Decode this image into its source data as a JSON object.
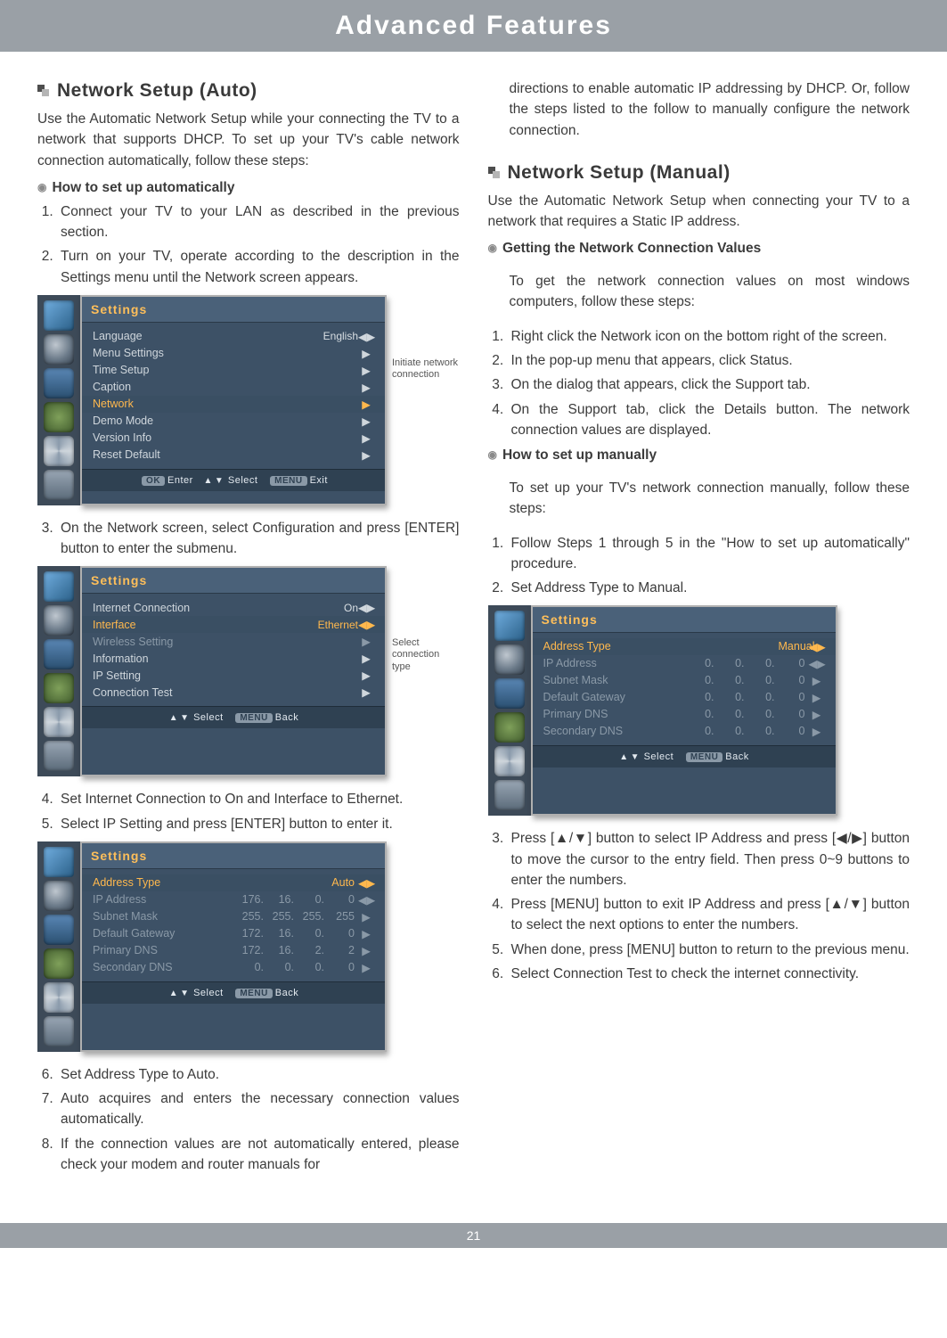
{
  "banner": "Advanced Features",
  "page_number": "21",
  "left": {
    "h_auto": "Network Setup (Auto)",
    "lead_auto": "Use the Automatic Network Setup while your connecting the TV to a network that supports DHCP. To set up your TV's cable network connection automatically, follow these steps:",
    "sub_auto": "How to set up automatically",
    "step1": "Connect your TV to your LAN as described in the previous section.",
    "step2": "Turn on your TV, operate according to the description in the Settings menu until the Network screen appears.",
    "step3": "On the Network screen, select Configuration and press [ENTER] button to enter the submenu.",
    "step4": "Set Internet Connection to On and Interface to Ethernet.",
    "step5": "Select IP Setting and press [ENTER] button to enter it.",
    "step6": "Set Address Type to Auto.",
    "step7": "Auto acquires and enters the necessary connection values automatically.",
    "step8": "If the connection values are not automatically entered, please check your modem and router manuals for",
    "callout1": "Initiate network connection",
    "callout2": "Select connection type"
  },
  "right": {
    "cont": "directions to enable automatic IP addressing by DHCP. Or, follow the steps listed to the follow to manually configure the network connection.",
    "h_manual": "Network Setup (Manual)",
    "lead_manual": "Use the Automatic Network Setup when connecting your TV to a network that requires a Static IP address.",
    "sub_get": "Getting the Network Connection Values",
    "get_lead": "To get the network connection values on most windows computers, follow these steps:",
    "g1": "Right click the Network icon on the bottom right of the screen.",
    "g2": "In the pop-up menu that appears, click Status.",
    "g3": "On the dialog that appears, click the Support tab.",
    "g4": "On the Support tab, click the Details button. The network connection values are displayed.",
    "sub_man": "How to set up manually",
    "man_lead": "To set up your TV's network connection manually, follow these steps:",
    "m1": "Follow Steps 1 through 5 in the \"How to set up automatically\" procedure.",
    "m2": "Set Address Type to Manual.",
    "m3": "Press [▲/▼] button to select IP Address and press [◀/▶] button to move the cursor to the entry field. Then press 0~9 buttons to enter the numbers.",
    "m4": "Press [MENU] button to exit IP Address and press [▲/▼] button to select the next options to enter the numbers.",
    "m5": "When done, press [MENU] button to return to the previous menu.",
    "m6": "Select Connection Test to check the internet connectivity."
  },
  "tv1": {
    "title": "Settings",
    "rows": [
      {
        "lbl": "Language",
        "val": "English",
        "arr": "◀▶"
      },
      {
        "lbl": "Menu Settings",
        "val": "",
        "arr": "▶"
      },
      {
        "lbl": "Time Setup",
        "val": "",
        "arr": "▶"
      },
      {
        "lbl": "Caption",
        "val": "",
        "arr": "▶"
      },
      {
        "lbl": "Network",
        "val": "",
        "arr": "▶",
        "hl": true
      },
      {
        "lbl": "Demo Mode",
        "val": "",
        "arr": "▶"
      },
      {
        "lbl": "Version Info",
        "val": "",
        "arr": "▶"
      },
      {
        "lbl": "Reset Default",
        "val": "",
        "arr": "▶"
      }
    ],
    "foot": {
      "ok": "OK",
      "enter": "Enter",
      "sel": "Select",
      "menu": "MENU",
      "exit": "Exit"
    }
  },
  "tv2": {
    "title": "Settings",
    "rows": [
      {
        "lbl": "Internet Connection",
        "val": "On",
        "arr": "◀▶"
      },
      {
        "lbl": "Interface",
        "val": "Ethernet",
        "arr": "◀▶",
        "hl": true
      },
      {
        "lbl": "Wireless Setting",
        "val": "",
        "arr": "▶",
        "dim": true
      },
      {
        "lbl": "Information",
        "val": "",
        "arr": "▶"
      },
      {
        "lbl": "IP Setting",
        "val": "",
        "arr": "▶"
      },
      {
        "lbl": "Connection Test",
        "val": "",
        "arr": "▶"
      }
    ],
    "foot": {
      "sel": "Select",
      "menu": "MENU",
      "back": "Back"
    }
  },
  "tv3": {
    "title": "Settings",
    "rows": [
      {
        "lbl": "Address Type",
        "c": [
          "",
          "",
          "",
          "Auto"
        ],
        "arr": "◀▶",
        "hl": true
      },
      {
        "lbl": "IP Address",
        "c": [
          "176.",
          "16.",
          "0.",
          "0"
        ],
        "arr": "◀▶",
        "dim": true
      },
      {
        "lbl": "Subnet Mask",
        "c": [
          "255.",
          "255.",
          "255.",
          "255"
        ],
        "arr": "▶",
        "dim": true
      },
      {
        "lbl": "Default Gateway",
        "c": [
          "172.",
          "16.",
          "0.",
          "0"
        ],
        "arr": "▶",
        "dim": true
      },
      {
        "lbl": "Primary DNS",
        "c": [
          "172.",
          "16.",
          "2.",
          "2"
        ],
        "arr": "▶",
        "dim": true
      },
      {
        "lbl": "Secondary DNS",
        "c": [
          "0.",
          "0.",
          "0.",
          "0"
        ],
        "arr": "▶",
        "dim": true
      }
    ],
    "foot": {
      "sel": "Select",
      "menu": "MENU",
      "back": "Back"
    }
  },
  "tv4": {
    "title": "Settings",
    "rows": [
      {
        "lbl": "Address Type",
        "c": [
          "",
          "",
          "",
          "Manual"
        ],
        "arr": "◀▶",
        "hl": true
      },
      {
        "lbl": "IP Address",
        "c": [
          "0.",
          "0.",
          "0.",
          "0"
        ],
        "arr": "◀▶",
        "dim": true
      },
      {
        "lbl": "Subnet Mask",
        "c": [
          "0.",
          "0.",
          "0.",
          "0"
        ],
        "arr": "▶",
        "dim": true
      },
      {
        "lbl": "Default Gateway",
        "c": [
          "0.",
          "0.",
          "0.",
          "0"
        ],
        "arr": "▶",
        "dim": true
      },
      {
        "lbl": "Primary DNS",
        "c": [
          "0.",
          "0.",
          "0.",
          "0"
        ],
        "arr": "▶",
        "dim": true
      },
      {
        "lbl": "Secondary DNS",
        "c": [
          "0.",
          "0.",
          "0.",
          "0"
        ],
        "arr": "▶",
        "dim": true
      }
    ],
    "foot": {
      "sel": "Select",
      "menu": "MENU",
      "back": "Back"
    }
  }
}
